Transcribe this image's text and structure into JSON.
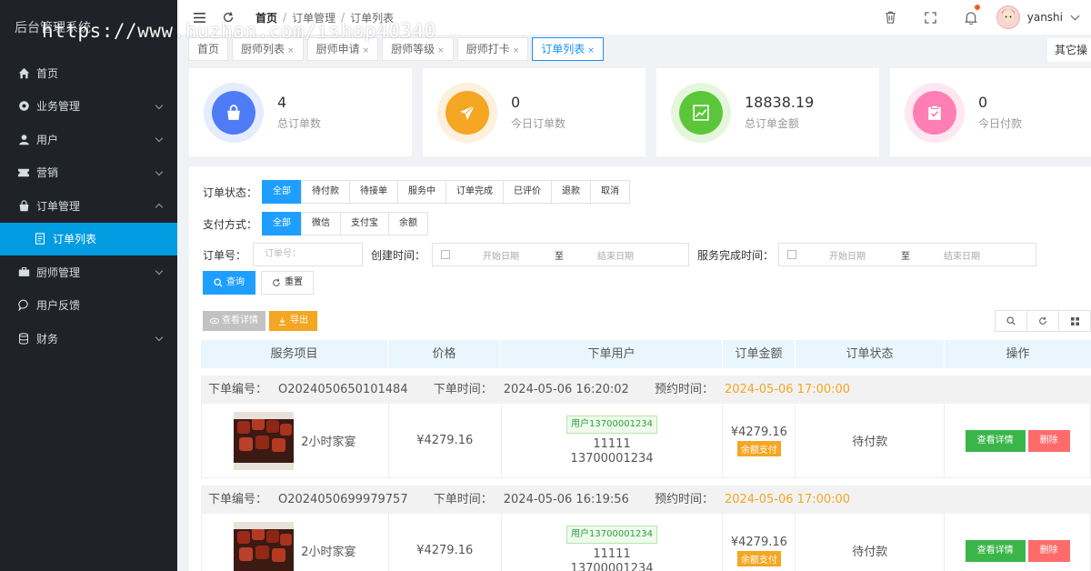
{
  "watermark": "https://www.huzhan.com/ishop40340",
  "sidebar": {
    "title": "后台管理系统",
    "items": [
      {
        "label": "首页",
        "icon": "home-icon"
      },
      {
        "label": "业务管理",
        "icon": "gear-icon"
      },
      {
        "label": "用户",
        "icon": "user-icon"
      },
      {
        "label": "营销",
        "icon": "ticket-icon"
      },
      {
        "label": "订单管理",
        "icon": "bag-icon"
      },
      {
        "label": "订单列表",
        "icon": "document-icon"
      },
      {
        "label": "厨师管理",
        "icon": "briefcase-icon"
      },
      {
        "label": "用户反馈",
        "icon": "chat-icon"
      },
      {
        "label": "财务",
        "icon": "database-icon"
      }
    ]
  },
  "breadcrumb": [
    "首页",
    "订单管理",
    "订单列表"
  ],
  "user": {
    "name": "yanshi"
  },
  "tabs": [
    "首页",
    "厨师列表",
    "厨师申请",
    "厨师等级",
    "厨师打卡",
    "订单列表"
  ],
  "tabs_more": "其它操",
  "stats": [
    {
      "value": "4",
      "label": "总订单数",
      "color": "#4e7cf6"
    },
    {
      "value": "0",
      "label": "今日订单数",
      "color": "#f5a623"
    },
    {
      "value": "18838.19",
      "label": "总订单金额",
      "color": "#5cc63a"
    },
    {
      "value": "0",
      "label": "今日付款",
      "color": "#ff7eb3"
    }
  ],
  "filters": {
    "status_label": "订单状态：",
    "status_options": [
      "全部",
      "待付款",
      "待接单",
      "服务中",
      "订单完成",
      "已评价",
      "退款",
      "取消"
    ],
    "pay_label": "支付方式：",
    "pay_options": [
      "全部",
      "微信",
      "支付宝",
      "余额"
    ],
    "order_no_label": "订单号：",
    "order_no_placeholder": "订单号：",
    "created_label": "创建时间：",
    "finished_label": "服务完成时间：",
    "start_placeholder": "开始日期",
    "to": "至",
    "end_placeholder": "结束日期",
    "search": "查询",
    "reset": "重置"
  },
  "actions": {
    "view": "查看详情",
    "export": "导出"
  },
  "table": {
    "columns": [
      "服务项目",
      "价格",
      "下单用户",
      "订单金额",
      "订单状态",
      "操作"
    ],
    "order_no_label": "下单编号：",
    "order_time_label": "下单时间：",
    "book_time_label": "预约时间：",
    "rows": [
      {
        "order_no": "O2024050650101484",
        "order_time": "2024-05-06 16:20:02",
        "book_time": "2024-05-06 17:00:00",
        "item": "2小时家宴",
        "price": "¥4279.16",
        "user_tag": "用户13700001234",
        "user_name": "11111",
        "user_phone": "13700001234",
        "amount": "¥4279.16",
        "pay_tag": "余额支付",
        "status": "待付款",
        "btn_view": "查看详情",
        "btn_delete": "删除"
      },
      {
        "order_no": "O2024050699979757",
        "order_time": "2024-05-06 16:19:56",
        "book_time": "2024-05-06 17:00:00",
        "item": "2小时家宴",
        "price": "¥4279.16",
        "user_tag": "用户13700001234",
        "user_name": "11111",
        "user_phone": "13700001234",
        "amount": "¥4279.16",
        "pay_tag": "余额支付",
        "status": "待付款",
        "btn_view": "查看详情",
        "btn_delete": "删除"
      }
    ]
  }
}
